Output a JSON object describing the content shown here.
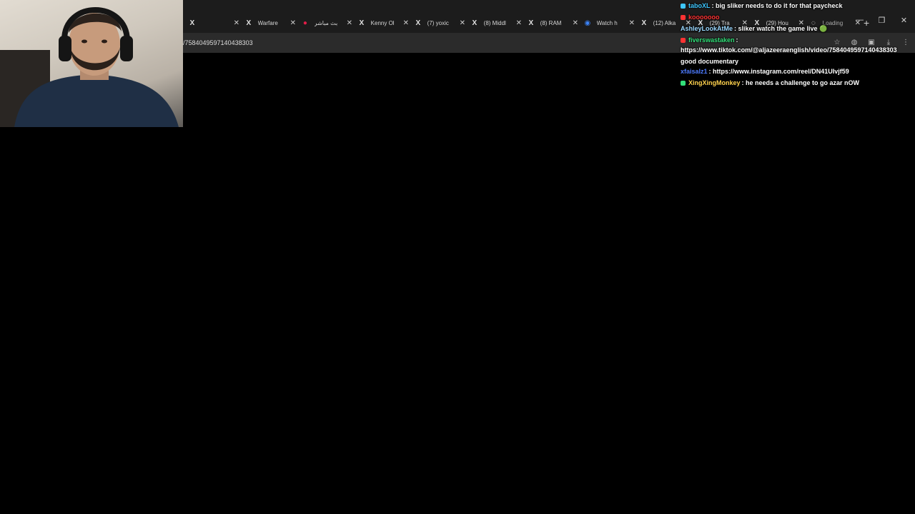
{
  "browser": {
    "tabs": [
      {
        "icon": "x-logo-icon",
        "glyph": "X",
        "label": "",
        "kind": "x"
      },
      {
        "icon": "x-logo-icon",
        "glyph": "X",
        "label": "Warfare",
        "kind": "x"
      },
      {
        "icon": "youtube-icon",
        "glyph": "●",
        "label": "بث مباشر",
        "kind": "yt"
      },
      {
        "icon": "x-logo-icon",
        "glyph": "X",
        "label": "Kenny Ol",
        "kind": "x"
      },
      {
        "icon": "x-logo-icon",
        "glyph": "X",
        "label": "(7) yoxic",
        "kind": "x"
      },
      {
        "icon": "x-logo-icon",
        "glyph": "X",
        "label": "(8) Middl",
        "kind": "x"
      },
      {
        "icon": "x-logo-icon",
        "glyph": "X",
        "label": "(8) RAM",
        "kind": "x"
      },
      {
        "icon": "globe-icon",
        "glyph": "◉",
        "label": "Watch h",
        "kind": "globe"
      },
      {
        "icon": "x-logo-icon",
        "glyph": "X",
        "label": "(12) Alka",
        "kind": "x"
      },
      {
        "icon": "x-logo-icon",
        "glyph": "X",
        "label": "(29) Tra",
        "kind": "x"
      },
      {
        "icon": "x-logo-icon",
        "glyph": "X",
        "label": "(29) Hou",
        "kind": "x"
      },
      {
        "icon": "loading-icon",
        "glyph": "◌",
        "label": "Loading",
        "kind": "loading"
      }
    ],
    "new_tab": "+",
    "window_controls": {
      "minimize": "—",
      "restore": "❐",
      "close": "✕"
    },
    "url": "/7584049597140438303",
    "toolbar_icons": [
      "star-icon",
      "extension-icon",
      "extension-icon",
      "download-icon",
      "menu-icon"
    ]
  },
  "chat": {
    "messages": [
      {
        "user": "taboXL",
        "user_color": "#3ec7ff",
        "badge_color": "#3ec7ff",
        "text": ": big sliker needs to do it for that paycheck"
      },
      {
        "user": "kooooooo",
        "user_color": "#ff3333",
        "badge_color": "#ff3333",
        "text": ""
      },
      {
        "user": "AshleyLookAtMe",
        "user_color": "#9ad8ff",
        "badge_color": "",
        "text": ": sliker watch the game live 🟢"
      },
      {
        "user": "fiverswastaken",
        "user_color": "#33e07a",
        "badge_color": "#ff3333",
        "text": ":"
      },
      {
        "user": "",
        "user_color": "#ffffff",
        "badge_color": "",
        "text": "https://www.tiktok.com/@aljazeeraenglish/video/7584049597140438303 good documentary"
      },
      {
        "user": "xfaisalz1",
        "user_color": "#4d7bff",
        "badge_color": "",
        "text": ": https://www.instagram.com/reel/DN41UIvjf59"
      },
      {
        "user": "XingXingMonkey",
        "user_color": "#ffd24d",
        "badge_color": "#33e07a",
        "text": ": he needs a challenge to go azar nOW"
      }
    ]
  }
}
